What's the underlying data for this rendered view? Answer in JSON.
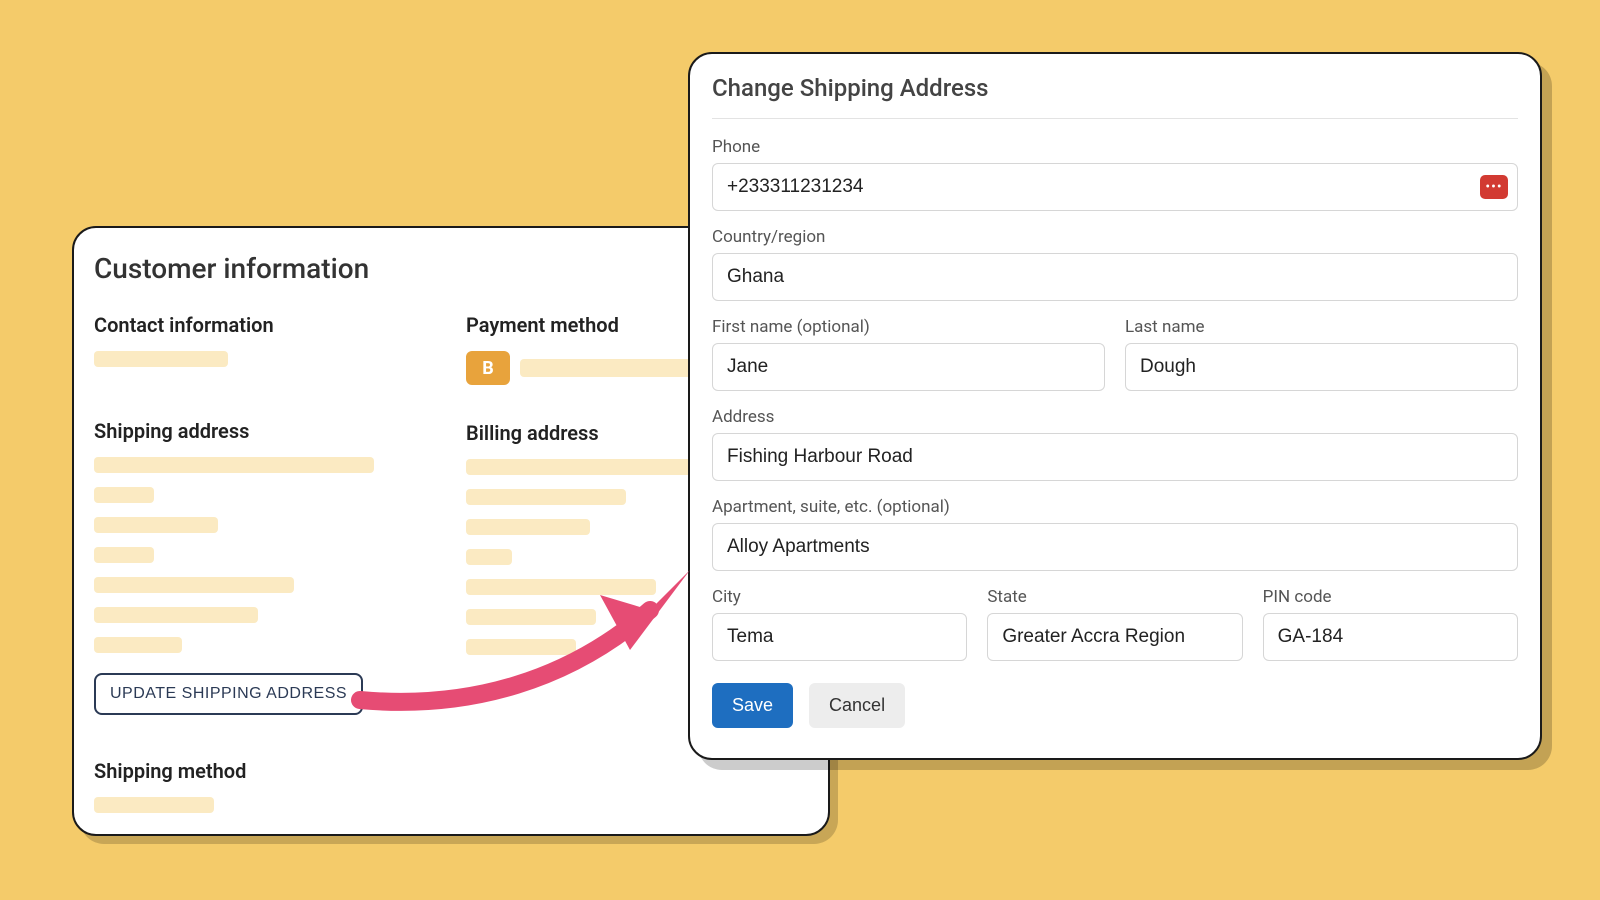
{
  "customer": {
    "title": "Customer information",
    "contact_heading": "Contact information",
    "payment_heading": "Payment method",
    "payment_badge": "B",
    "shipping_heading": "Shipping address",
    "billing_heading": "Billing address",
    "update_btn": "UPDATE SHIPPING ADDRESS",
    "shipping_method_heading": "Shipping method"
  },
  "modal": {
    "title": "Change Shipping Address",
    "labels": {
      "phone": "Phone",
      "country": "Country/region",
      "first_name": "First name (optional)",
      "last_name": "Last name",
      "address": "Address",
      "apartment": "Apartment, suite, etc. (optional)",
      "city": "City",
      "state": "State",
      "pin": "PIN code"
    },
    "values": {
      "phone": "+233311231234",
      "country": "Ghana",
      "first_name": "Jane",
      "last_name": "Dough",
      "address": "Fishing Harbour Road",
      "apartment": "Alloy Apartments",
      "city": "Tema",
      "state": "Greater Accra Region",
      "pin": "GA-184"
    },
    "save": "Save",
    "cancel": "Cancel",
    "phone_badge": "•••"
  }
}
